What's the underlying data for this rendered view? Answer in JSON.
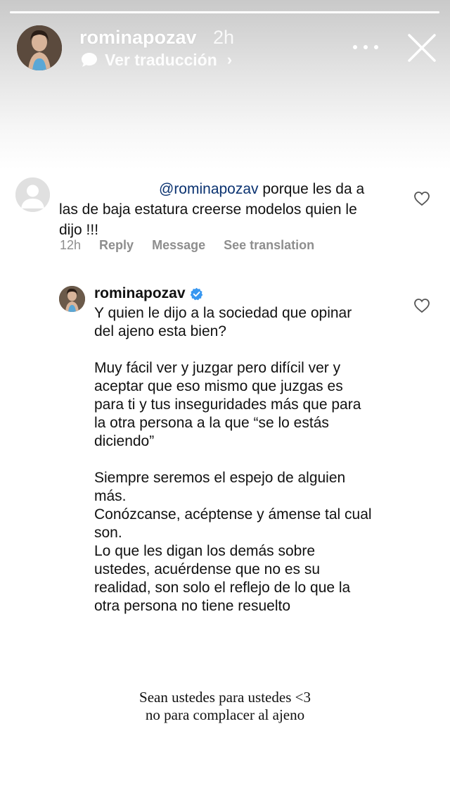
{
  "story": {
    "username": "rominapozav",
    "time": "2h",
    "translate_label": "Ver traducción",
    "progress": 1.0
  },
  "comment": {
    "mention": "@rominapozav",
    "line1_rest": " porque les da a",
    "line2": "las de baja estatura creerse modelos quien le",
    "line3": "dijo !!!",
    "time": "12h",
    "reply_label": "Reply",
    "message_label": "Message",
    "translate_label": "See translation"
  },
  "reply": {
    "username": "rominapozav",
    "paragraphs": [
      [
        "Y quien le dijo a la sociedad que opinar",
        "del ajeno esta bien?"
      ],
      [
        "Muy fácil ver y juzgar pero difícil ver y",
        "aceptar que eso mismo que juzgas es",
        "para ti y tus inseguridades más que para",
        "la otra persona a la que “se lo estás",
        "diciendo”"
      ],
      [
        "Siempre seremos el espejo de alguien",
        "más.",
        "Conózcanse, acéptense y ámense tal cual",
        "son.",
        "Lo que les digan los demás sobre",
        "ustedes, acuérdense que no es su",
        "realidad, son solo el reflejo de lo que la",
        "otra persona no tiene resuelto"
      ]
    ]
  },
  "caption": {
    "line1": "Sean ustedes para ustedes <3",
    "line2": "no para complacer al ajeno"
  },
  "colors": {
    "mention": "#0a3270",
    "meta_gray": "#8e8e8e",
    "verified_blue": "#3897f0"
  },
  "icons": [
    "translate-bubble-icon",
    "chevron-right-icon",
    "more-icon",
    "close-icon",
    "heart-icon",
    "verified-badge-icon"
  ]
}
